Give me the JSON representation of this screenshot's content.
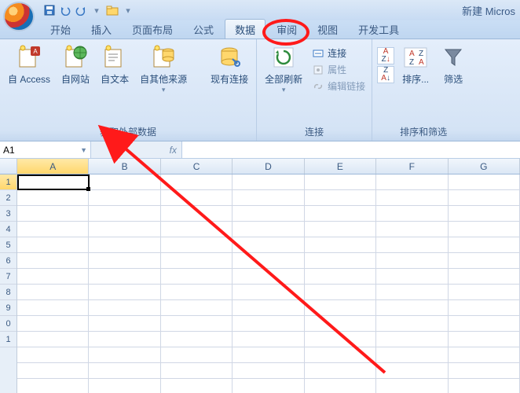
{
  "title": "新建 Micros",
  "tabs": {
    "start": "开始",
    "insert": "插入",
    "pagelayout": "页面布局",
    "formulas": "公式",
    "data": "数据",
    "review": "审阅",
    "view": "视图",
    "devtools": "开发工具"
  },
  "ribbon": {
    "external": {
      "access": "Access",
      "access_prefix": "自",
      "web": "自网站",
      "text": "自文本",
      "other": "自其他来源",
      "existing": "现有连接",
      "group_label": "获取外部数据"
    },
    "connections": {
      "refresh": "全部刷新",
      "conn": "连接",
      "props": "属性",
      "editlinks": "编辑链接",
      "group_label": "连接"
    },
    "sort": {
      "sort_btn": "排序...",
      "filter": "筛选",
      "group_label": "排序和筛选"
    }
  },
  "namebox": "A1",
  "fx_label": "fx",
  "columns": [
    "A",
    "B",
    "C",
    "D",
    "E",
    "F",
    "G"
  ],
  "rows": [
    "1",
    "2",
    "3",
    "4",
    "5",
    "6",
    "7",
    "8",
    "9",
    "0",
    "1"
  ],
  "row_hdrs_active": "1"
}
